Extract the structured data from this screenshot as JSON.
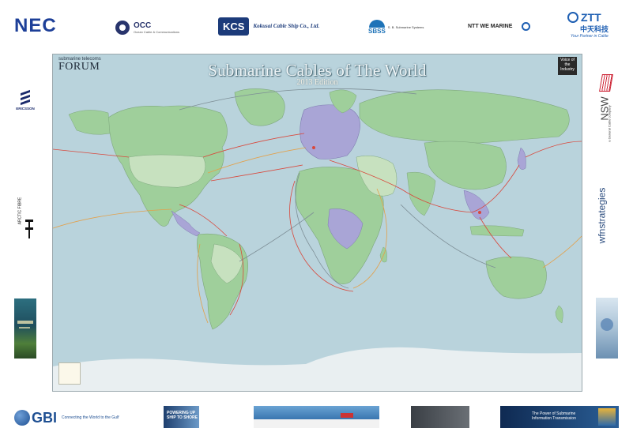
{
  "sponsors_top": {
    "nec": "NEC",
    "occ_name": "OCC",
    "occ_sub": "Ocean Cable & Communications",
    "kcs_mark": "KCS",
    "kcs_name": "Kokusai Cable Ship Co., Ltd.",
    "sbss_mark": "SBSS",
    "sbss_name": "S. B. Submarine Systems",
    "ntt": "NTT WE MARINE",
    "ztt_mark": "ZTT",
    "ztt_cn": "中天科技",
    "ztt_tag": "Your Partner in Cable"
  },
  "sponsors_left": {
    "ericsson": "ERICSSON",
    "arctic": "ARCTIC FIBRE"
  },
  "sponsors_right": {
    "nsw": "NSW",
    "nsw_sub": "a General Cable company",
    "wfn": "wfnstrategies"
  },
  "sponsors_bottom": {
    "gbi_mark": "GBI",
    "gbi_tag": "Connecting the World to the Gulf",
    "banner1": "POWERING UP SHIP TO SHORE",
    "banner5": "The Power of Submarine Information Transmission"
  },
  "map": {
    "forum_small": "submarine telecoms",
    "forum_big": "FORUM",
    "title": "Submarine Cables of The World",
    "edition": "2013 Edition",
    "voice": "Voice of the Industry"
  },
  "colors": {
    "ocean": "#b9d3dc",
    "land_green": "#9fcf9b",
    "land_purple": "#a9a5d6",
    "ice": "#e9eff1",
    "cable_red": "#d9483c",
    "cable_orange": "#e3a04a",
    "cable_grey": "#7d8e96"
  }
}
